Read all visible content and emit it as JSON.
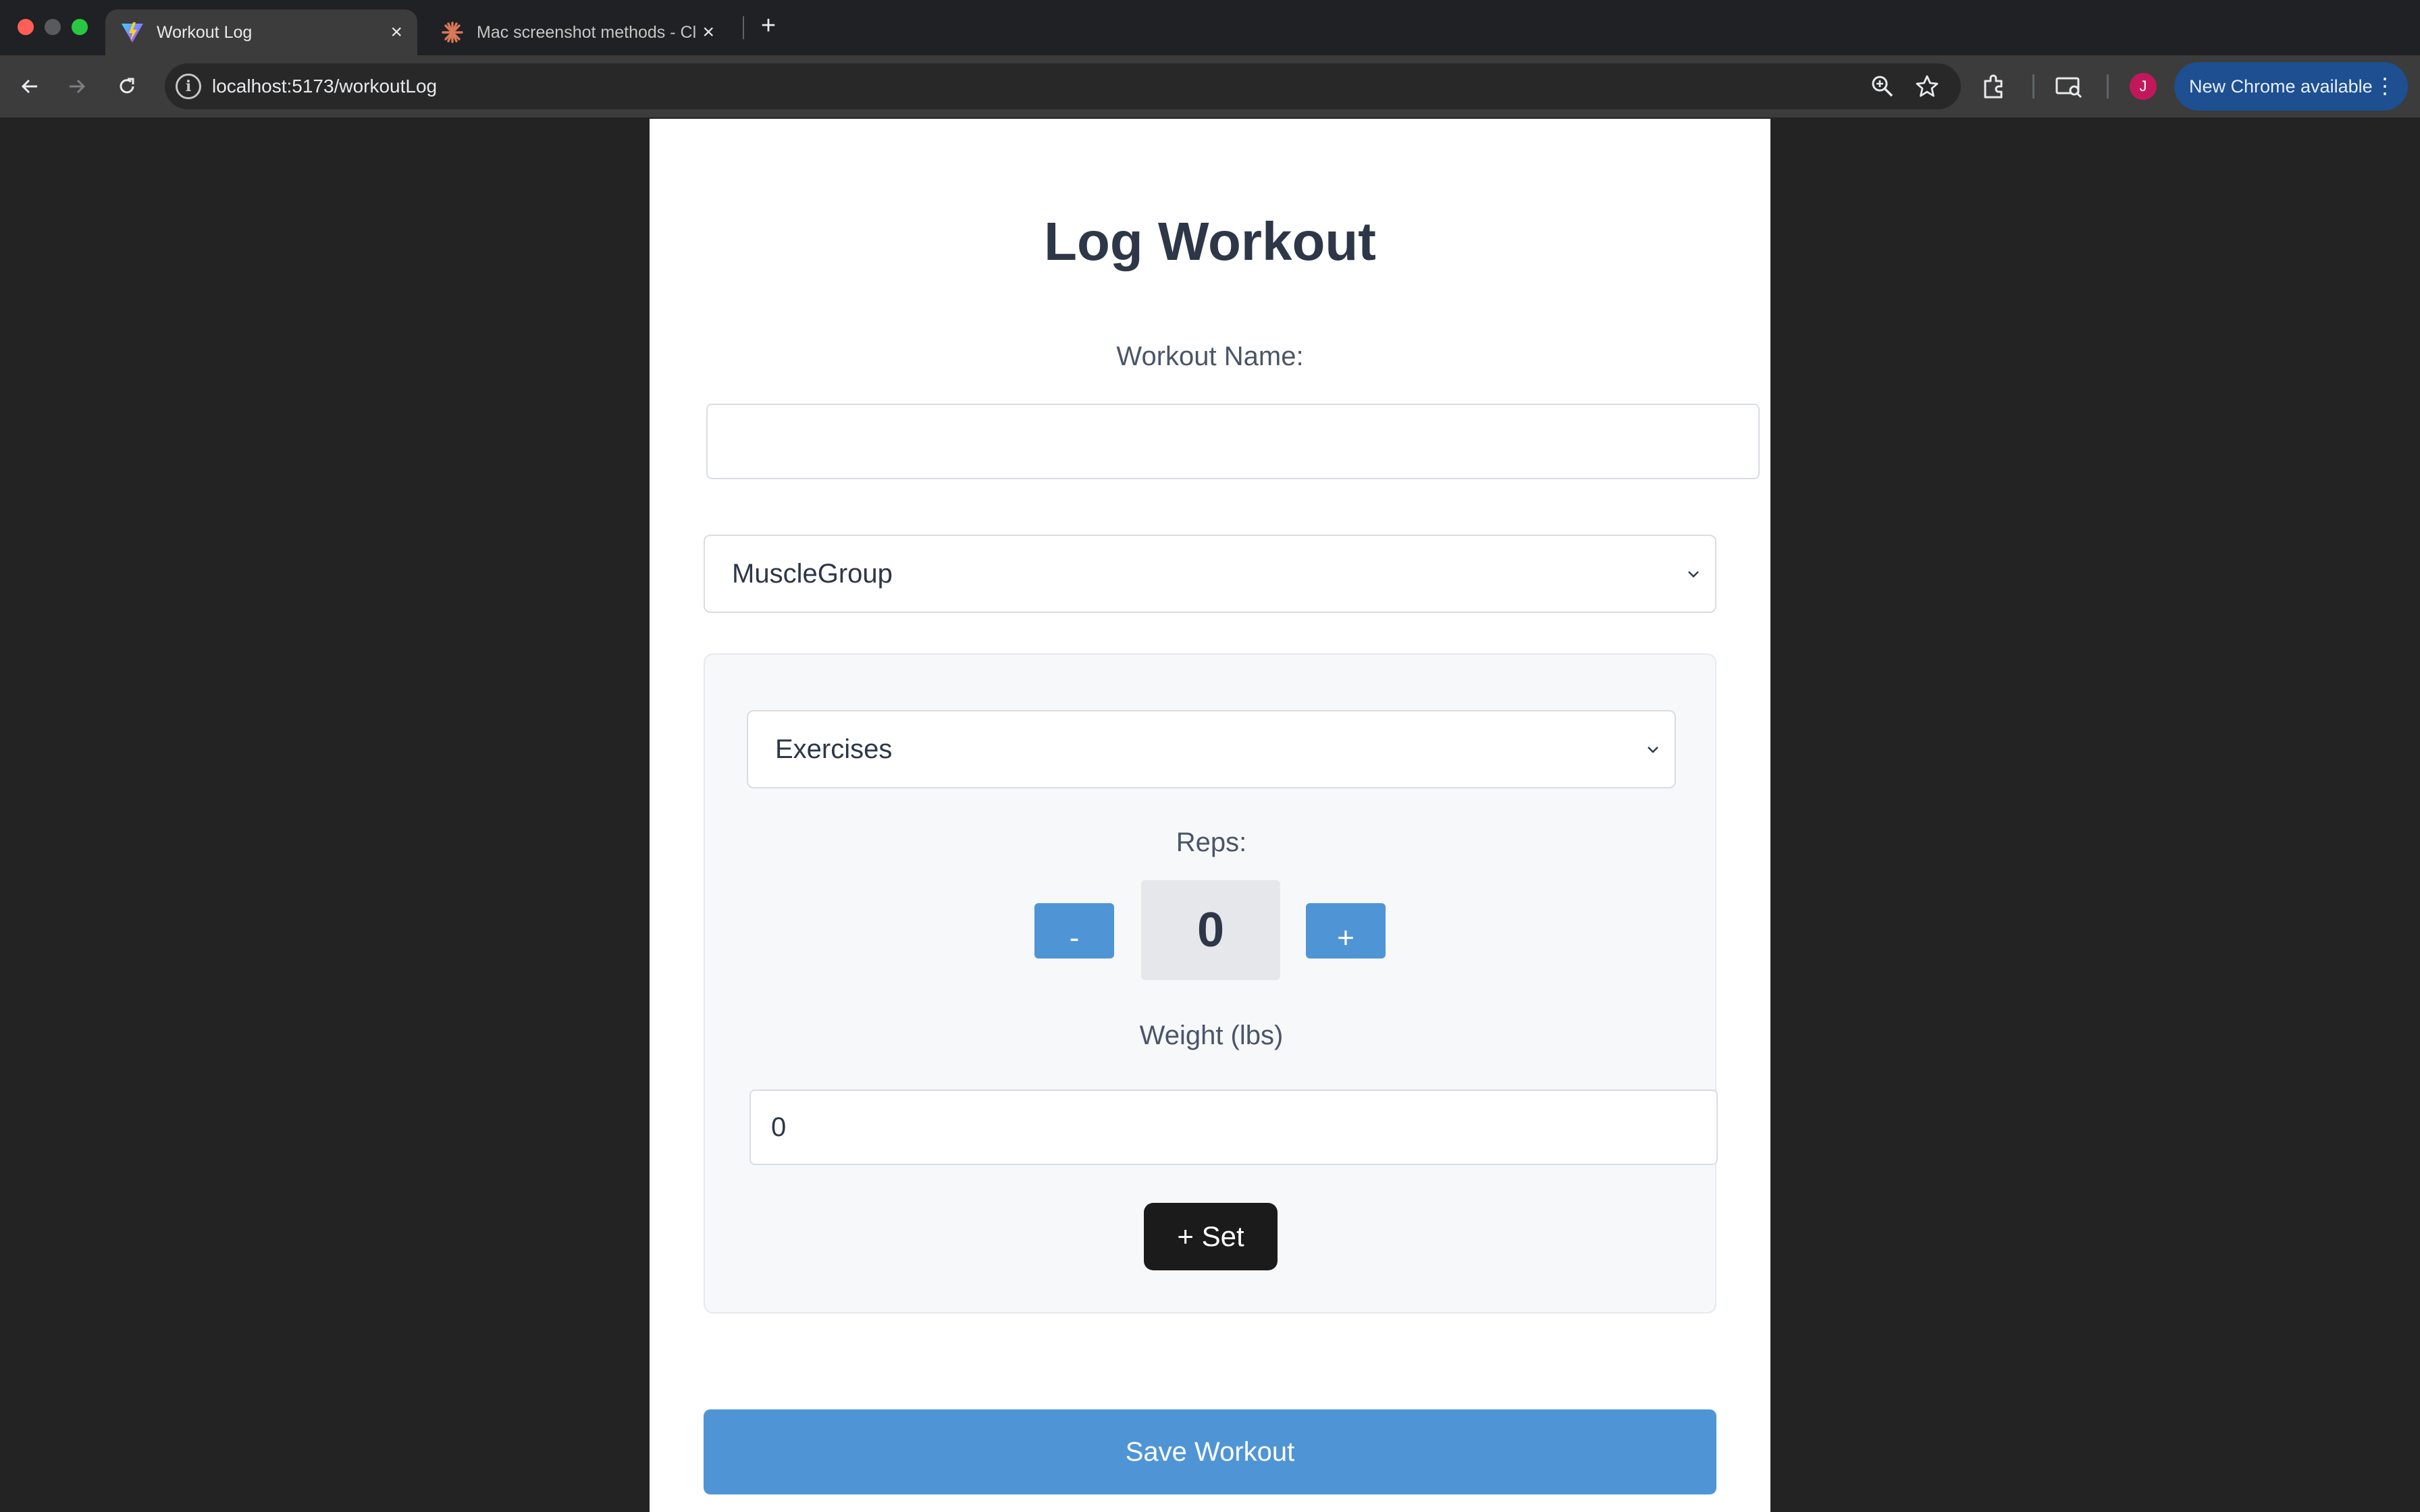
{
  "browser": {
    "tabs": [
      {
        "title": "Workout Log",
        "active": true,
        "icon": "vite-logo-icon"
      },
      {
        "title": "Mac screenshot methods - Cl",
        "active": false,
        "icon": "claude-logo-icon"
      }
    ],
    "url": "localhost:5173/workoutLog",
    "profile_initial": "J",
    "update_button_label": "New Chrome available",
    "accent_color": "#1d4f91"
  },
  "form": {
    "title": "Log Workout",
    "workout_name_label": "Workout Name:",
    "workout_name_value": "",
    "muscle_group_select": "MuscleGroup",
    "exercise_select": "Exercises",
    "reps_label": "Reps:",
    "reps_minus": "-",
    "reps_plus": "+",
    "reps_value": "0",
    "weight_label": "Weight (lbs)",
    "weight_value": "0",
    "add_set_label": "+ Set",
    "save_label": "Save Workout",
    "primary_color": "#4f95d6"
  }
}
